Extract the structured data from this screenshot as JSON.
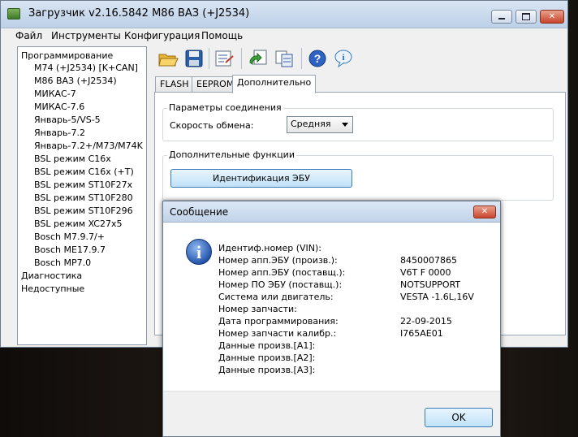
{
  "window": {
    "title": "Загрузчик v2.16.5842 M86 ВАЗ (+J2534)",
    "min_icon": "minimize-glyph",
    "max_icon": "maximize-glyph",
    "close_glyph": "✕"
  },
  "menu": [
    "Файл",
    "Инструменты",
    "Конфигурация",
    "Помощь"
  ],
  "tree": {
    "root": "Программирование",
    "items": [
      "M74 (+J2534) [K+CAN]",
      "M86 ВАЗ (+J2534)",
      "МИКАС-7",
      "МИКАС-7.6",
      "Январь-5/VS-5",
      "Январь-7.2",
      "Январь-7.2+/M73/M74K",
      "BSL режим C16x",
      "BSL режим C16x (+T)",
      "BSL режим ST10F27x",
      "BSL режим ST10F280",
      "BSL режим ST10F296",
      "BSL режим XC27x5",
      "Bosch M7.9.7/+",
      "Bosch ME17.9.7",
      "Bosch MP7.0"
    ],
    "extra": [
      "Диагностика",
      "Недоступные"
    ]
  },
  "toolbar": {
    "icons": [
      "open-folder-icon",
      "save-disk-icon",
      "read-ecu-icon",
      "write-ecu-icon",
      "compare-icon",
      "help-icon",
      "info-icon"
    ]
  },
  "tabs": [
    "FLASH",
    "EEPROM",
    "Дополнительно"
  ],
  "panel": {
    "connection_group": "Параметры соединения",
    "speed_label": "Скорость обмена:",
    "speed_value": "Средняя",
    "functions_group": "Дополнительные функции",
    "identify_button": "Идентификация ЭБУ"
  },
  "dialog": {
    "title": "Сообщение",
    "close_glyph": "✕",
    "info_glyph": "i",
    "rows": [
      {
        "label": "Идентиф.номер (VIN):",
        "value": ""
      },
      {
        "label": "Номер апп.ЭБУ (произв.):",
        "value": "8450007865"
      },
      {
        "label": "Номер апп.ЭБУ (поставщ.):",
        "value": "V6T F 0000"
      },
      {
        "label": "Номер ПО ЭБУ (поставщ.):",
        "value": "NOTSUPPORT"
      },
      {
        "label": "Система или двигатель:",
        "value": "VESTA -1.6L,16V"
      },
      {
        "label": "Номер запчасти:",
        "value": ""
      },
      {
        "label": "Дата программирования:",
        "value": "22-09-2015"
      },
      {
        "label": "Номер запчасти калибр.:",
        "value": "I765AE01"
      },
      {
        "label": "Данные произв.[A1]:",
        "value": ""
      },
      {
        "label": "Данные произв.[A2]:",
        "value": ""
      },
      {
        "label": "Данные произв.[A3]:",
        "value": ""
      }
    ],
    "ok_label": "OK"
  },
  "colors": {
    "accent": "#3a7ab8",
    "titlebar": "#c1d3e9",
    "info_blue": "#2e5fb8"
  }
}
